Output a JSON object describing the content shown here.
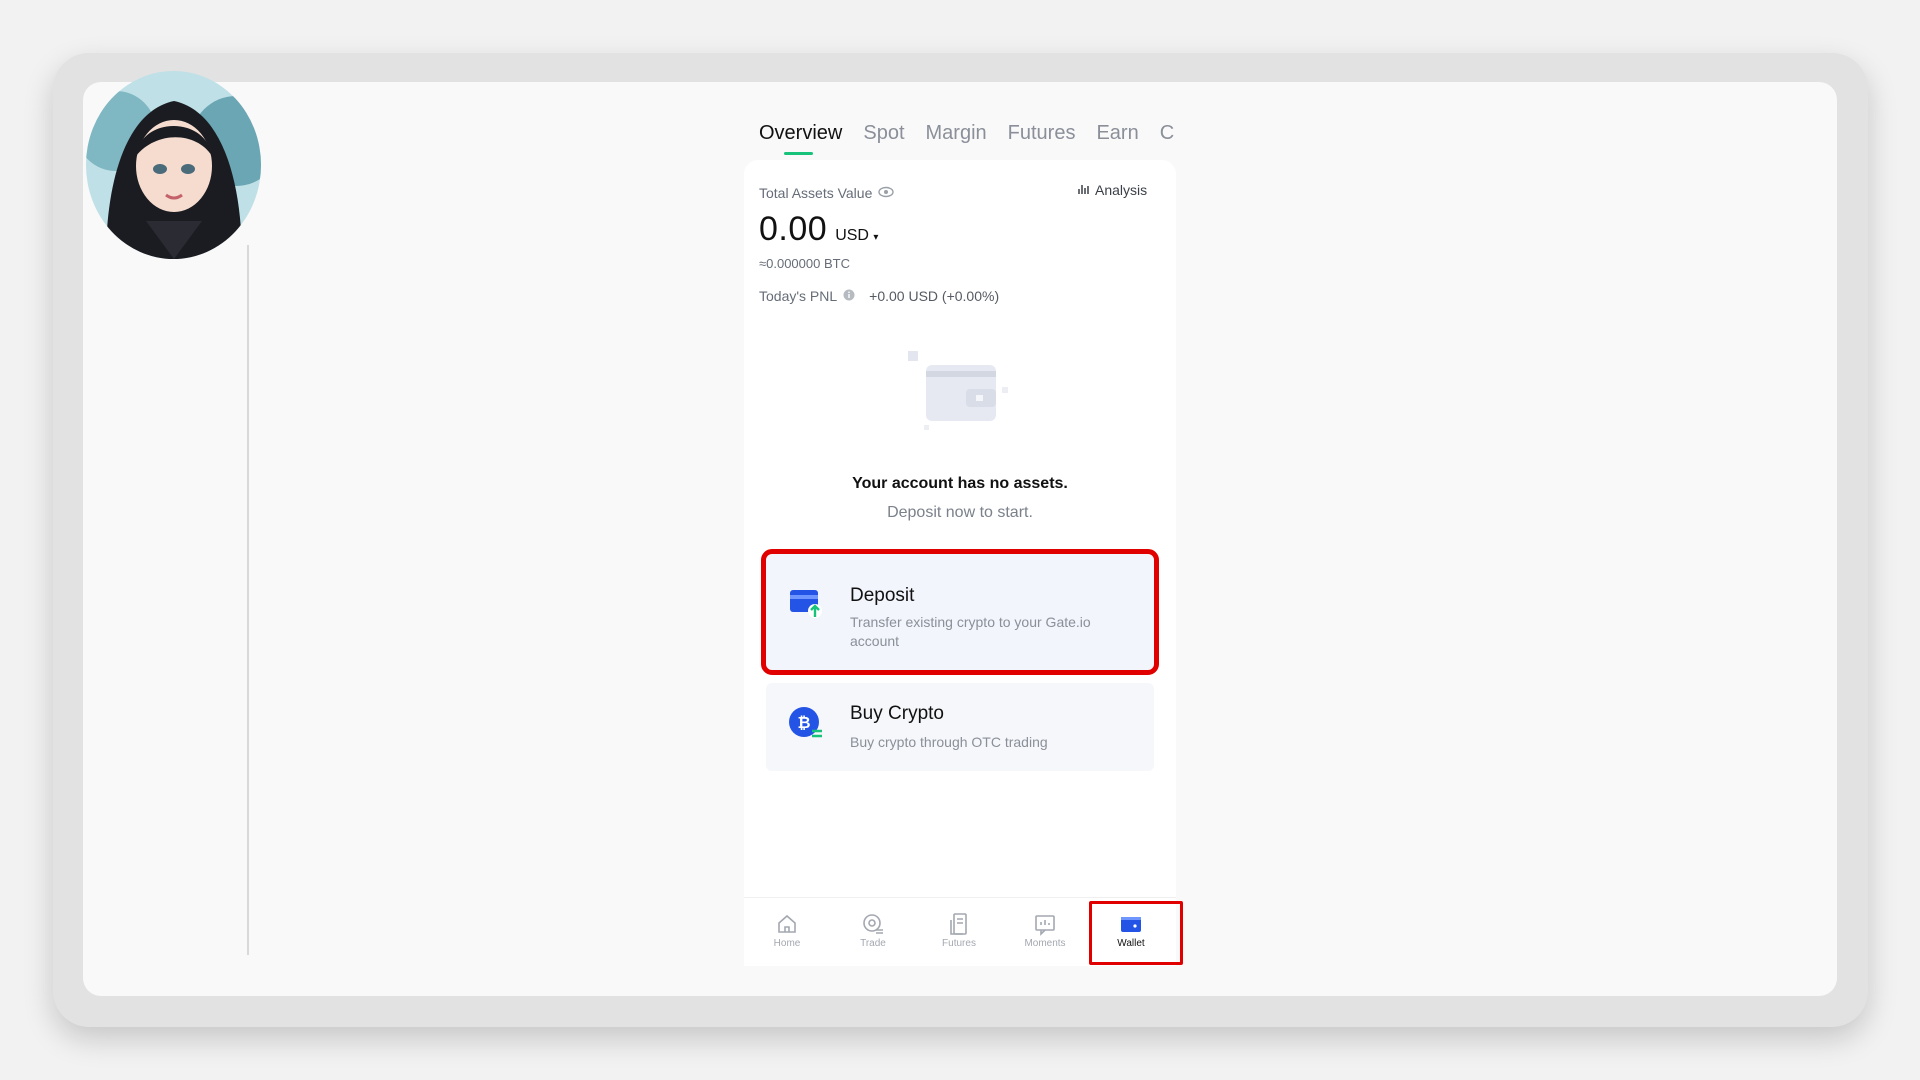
{
  "tabs": [
    "Overview",
    "Spot",
    "Margin",
    "Futures",
    "Earn",
    "Co"
  ],
  "assets": {
    "label": "Total Assets Value",
    "analysis": "Analysis",
    "amount": "0.00",
    "currency": "USD",
    "btc": "≈0.000000 BTC",
    "pnl_label": "Today's PNL",
    "pnl_value": "+0.00 USD (+0.00%)"
  },
  "empty": {
    "title": "Your account has no assets.",
    "subtitle": "Deposit now to start."
  },
  "cards": {
    "deposit": {
      "title": "Deposit",
      "desc": "Transfer existing crypto to your Gate.io account"
    },
    "buy": {
      "title": "Buy Crypto",
      "desc": "Buy crypto through OTC trading"
    }
  },
  "nav": {
    "home": "Home",
    "trade": "Trade",
    "futures": "Futures",
    "moments": "Moments",
    "wallet": "Wallet"
  },
  "colors": {
    "accent_green": "#17c37b",
    "brand_blue": "#2354e6",
    "highlight_red": "#e00000"
  }
}
